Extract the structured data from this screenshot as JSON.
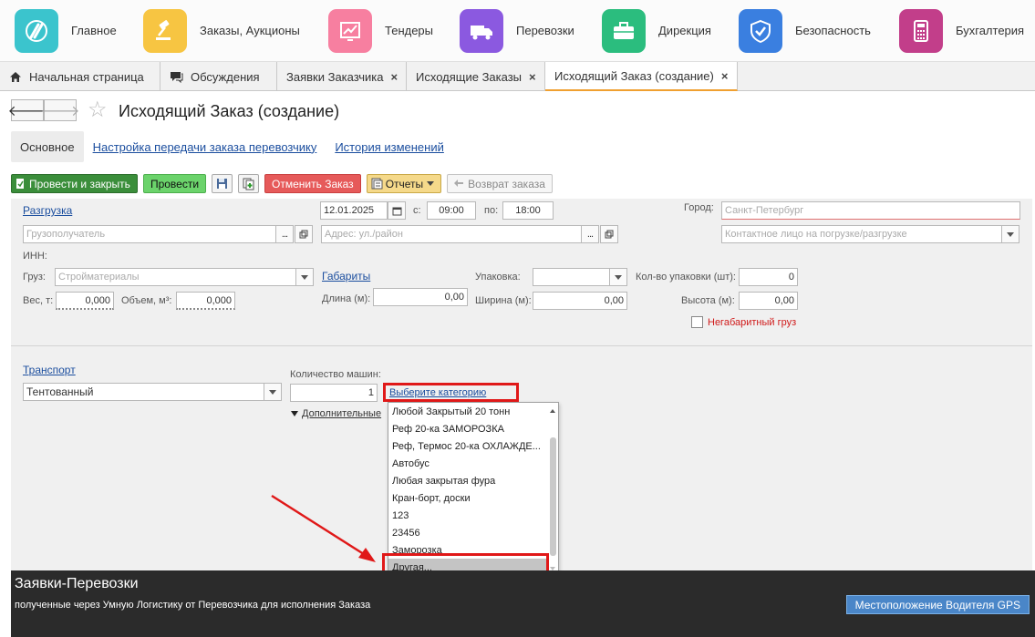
{
  "sections": [
    {
      "label": "Главное",
      "icon": "logo-icon",
      "color": "#3bc4cd"
    },
    {
      "label": "Заказы, Аукционы",
      "icon": "gavel-icon",
      "color": "#f7c542"
    },
    {
      "label": "Тендеры",
      "icon": "chart-icon",
      "color": "#f77fa0"
    },
    {
      "label": "Перевозки",
      "icon": "truck-icon",
      "color": "#8b59e0"
    },
    {
      "label": "Дирекция",
      "icon": "briefcase-icon",
      "color": "#2bbd7e"
    },
    {
      "label": "Безопасность",
      "icon": "shield-icon",
      "color": "#3a7fe0"
    },
    {
      "label": "Бухгалтерия",
      "icon": "calculator-icon",
      "color": "#c23e8a"
    }
  ],
  "tabs": [
    {
      "label": "Начальная страница",
      "icon": "home-icon"
    },
    {
      "label": "Обсуждения",
      "icon": "chat-icon"
    },
    {
      "label": "Заявки Заказчика",
      "closable": true
    },
    {
      "label": "Исходящие Заказы",
      "closable": true
    },
    {
      "label": "Исходящий Заказ (создание)",
      "closable": true,
      "active": true
    }
  ],
  "header": {
    "back": "🡐",
    "forward": "🡒",
    "title": "Исходящий Заказ (создание)"
  },
  "subnav": {
    "main": "Основное",
    "link1": "Настройка передачи заказа перевозчику",
    "link2": "История изменений"
  },
  "toolbar": {
    "post_close": "Провести и закрыть",
    "post": "Провести",
    "cancel_order": "Отменить Заказ",
    "reports": "Отчеты",
    "return_order": "Возврат заказа"
  },
  "form": {
    "unload_link": "Разгрузка",
    "date": "12.01.2025",
    "from_label": "с:",
    "from_time": "09:00",
    "to_label": "по:",
    "to_time": "18:00",
    "city_label": "Город:",
    "city_placeholder": "Санкт-Петербург",
    "consignee_placeholder": "Грузополучатель",
    "address_placeholder": "Адрес: ул./район",
    "contact_placeholder": "Контактное лицо на погрузке/разгрузке",
    "inn_label": "ИНН:",
    "cargo_label": "Груз:",
    "cargo_placeholder": "Стройматериалы",
    "dims_link": "Габариты",
    "packing_label": "Упаковка:",
    "packing_count_label": "Кол-во упаковки (шт):",
    "packing_count": "0",
    "weight_label": "Вес, т:",
    "weight": "0,000",
    "volume_label": "Объем, м³:",
    "volume": "0,000",
    "length_label": "Длина (м):",
    "length": "0,00",
    "width_label": "Ширина (м):",
    "width": "0,00",
    "height_label": "Высота (м):",
    "height": "0,00",
    "oversize_label": "Негабаритный груз",
    "transport_link": "Транспорт",
    "transport_value": "Тентованный",
    "cars_label": "Количество машин:",
    "cars_count": "1",
    "category_link": "Выберите категорию",
    "additional_label": "Дополнительные"
  },
  "dropdown": {
    "items": [
      "Любой Закрытый 20 тонн",
      "Реф 20-ка ЗАМОРОЗКА",
      "Реф, Термос 20-ка ОХЛАЖДЕ...",
      "Автобус",
      "Любая закрытая фура",
      "Кран-борт, доски",
      "123",
      "23456",
      "Заморозка",
      "Другая..."
    ],
    "selected_index": 9
  },
  "bottom": {
    "title": "Заявки-Перевозки",
    "subtitle": "полученные через Умную Логистику от Перевозчика для исполнения Заказа",
    "gps_button": "Местоположение Водителя GPS"
  }
}
